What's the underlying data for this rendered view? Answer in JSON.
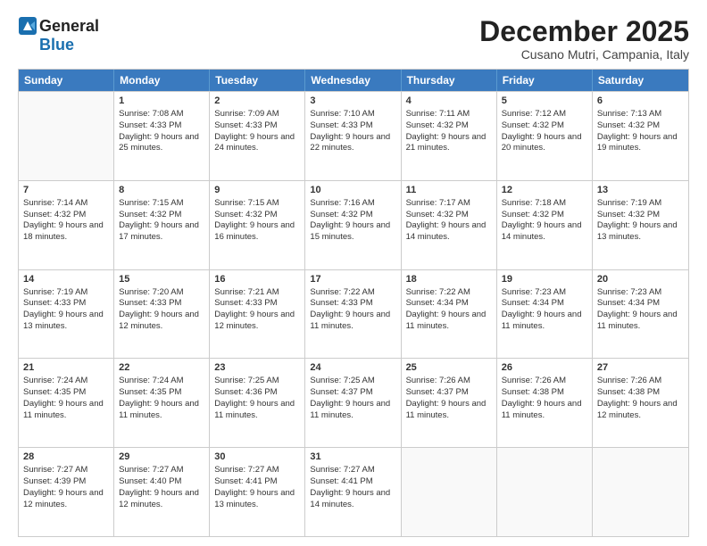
{
  "logo": {
    "line1": "General",
    "line2": "Blue"
  },
  "title": "December 2025",
  "location": "Cusano Mutri, Campania, Italy",
  "days_of_week": [
    "Sunday",
    "Monday",
    "Tuesday",
    "Wednesday",
    "Thursday",
    "Friday",
    "Saturday"
  ],
  "weeks": [
    [
      {
        "day": "",
        "empty": true
      },
      {
        "day": "1",
        "sunrise": "7:08 AM",
        "sunset": "4:33 PM",
        "daylight": "9 hours and 25 minutes."
      },
      {
        "day": "2",
        "sunrise": "7:09 AM",
        "sunset": "4:33 PM",
        "daylight": "9 hours and 24 minutes."
      },
      {
        "day": "3",
        "sunrise": "7:10 AM",
        "sunset": "4:33 PM",
        "daylight": "9 hours and 22 minutes."
      },
      {
        "day": "4",
        "sunrise": "7:11 AM",
        "sunset": "4:32 PM",
        "daylight": "9 hours and 21 minutes."
      },
      {
        "day": "5",
        "sunrise": "7:12 AM",
        "sunset": "4:32 PM",
        "daylight": "9 hours and 20 minutes."
      },
      {
        "day": "6",
        "sunrise": "7:13 AM",
        "sunset": "4:32 PM",
        "daylight": "9 hours and 19 minutes."
      }
    ],
    [
      {
        "day": "7",
        "sunrise": "7:14 AM",
        "sunset": "4:32 PM",
        "daylight": "9 hours and 18 minutes."
      },
      {
        "day": "8",
        "sunrise": "7:15 AM",
        "sunset": "4:32 PM",
        "daylight": "9 hours and 17 minutes."
      },
      {
        "day": "9",
        "sunrise": "7:15 AM",
        "sunset": "4:32 PM",
        "daylight": "9 hours and 16 minutes."
      },
      {
        "day": "10",
        "sunrise": "7:16 AM",
        "sunset": "4:32 PM",
        "daylight": "9 hours and 15 minutes."
      },
      {
        "day": "11",
        "sunrise": "7:17 AM",
        "sunset": "4:32 PM",
        "daylight": "9 hours and 14 minutes."
      },
      {
        "day": "12",
        "sunrise": "7:18 AM",
        "sunset": "4:32 PM",
        "daylight": "9 hours and 14 minutes."
      },
      {
        "day": "13",
        "sunrise": "7:19 AM",
        "sunset": "4:32 PM",
        "daylight": "9 hours and 13 minutes."
      }
    ],
    [
      {
        "day": "14",
        "sunrise": "7:19 AM",
        "sunset": "4:33 PM",
        "daylight": "9 hours and 13 minutes."
      },
      {
        "day": "15",
        "sunrise": "7:20 AM",
        "sunset": "4:33 PM",
        "daylight": "9 hours and 12 minutes."
      },
      {
        "day": "16",
        "sunrise": "7:21 AM",
        "sunset": "4:33 PM",
        "daylight": "9 hours and 12 minutes."
      },
      {
        "day": "17",
        "sunrise": "7:22 AM",
        "sunset": "4:33 PM",
        "daylight": "9 hours and 11 minutes."
      },
      {
        "day": "18",
        "sunrise": "7:22 AM",
        "sunset": "4:34 PM",
        "daylight": "9 hours and 11 minutes."
      },
      {
        "day": "19",
        "sunrise": "7:23 AM",
        "sunset": "4:34 PM",
        "daylight": "9 hours and 11 minutes."
      },
      {
        "day": "20",
        "sunrise": "7:23 AM",
        "sunset": "4:34 PM",
        "daylight": "9 hours and 11 minutes."
      }
    ],
    [
      {
        "day": "21",
        "sunrise": "7:24 AM",
        "sunset": "4:35 PM",
        "daylight": "9 hours and 11 minutes."
      },
      {
        "day": "22",
        "sunrise": "7:24 AM",
        "sunset": "4:35 PM",
        "daylight": "9 hours and 11 minutes."
      },
      {
        "day": "23",
        "sunrise": "7:25 AM",
        "sunset": "4:36 PM",
        "daylight": "9 hours and 11 minutes."
      },
      {
        "day": "24",
        "sunrise": "7:25 AM",
        "sunset": "4:37 PM",
        "daylight": "9 hours and 11 minutes."
      },
      {
        "day": "25",
        "sunrise": "7:26 AM",
        "sunset": "4:37 PM",
        "daylight": "9 hours and 11 minutes."
      },
      {
        "day": "26",
        "sunrise": "7:26 AM",
        "sunset": "4:38 PM",
        "daylight": "9 hours and 11 minutes."
      },
      {
        "day": "27",
        "sunrise": "7:26 AM",
        "sunset": "4:38 PM",
        "daylight": "9 hours and 12 minutes."
      }
    ],
    [
      {
        "day": "28",
        "sunrise": "7:27 AM",
        "sunset": "4:39 PM",
        "daylight": "9 hours and 12 minutes."
      },
      {
        "day": "29",
        "sunrise": "7:27 AM",
        "sunset": "4:40 PM",
        "daylight": "9 hours and 12 minutes."
      },
      {
        "day": "30",
        "sunrise": "7:27 AM",
        "sunset": "4:41 PM",
        "daylight": "9 hours and 13 minutes."
      },
      {
        "day": "31",
        "sunrise": "7:27 AM",
        "sunset": "4:41 PM",
        "daylight": "9 hours and 14 minutes."
      },
      {
        "day": "",
        "empty": true
      },
      {
        "day": "",
        "empty": true
      },
      {
        "day": "",
        "empty": true
      }
    ]
  ]
}
